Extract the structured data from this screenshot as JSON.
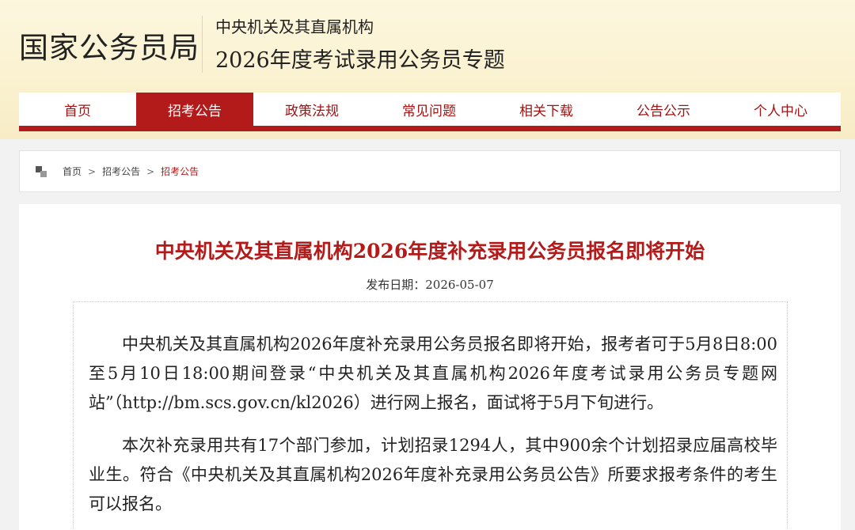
{
  "header": {
    "logo_text": "国家公务员局",
    "subtitle_small": "中央机关及其直属机构",
    "subtitle_large": "2026年度考试录用公务员专题"
  },
  "nav": {
    "items": [
      {
        "label": "首页"
      },
      {
        "label": "招考公告"
      },
      {
        "label": "政策法规"
      },
      {
        "label": "常见问题"
      },
      {
        "label": "相关下载"
      },
      {
        "label": "公告公示"
      },
      {
        "label": "个人中心"
      }
    ],
    "active_index": 1
  },
  "breadcrumb": {
    "icon": "home-icon",
    "items": [
      "首页",
      "招考公告",
      "招考公告"
    ],
    "separator": ">"
  },
  "article": {
    "title": "中央机关及其直属机构2026年度补充录用公务员报名即将开始",
    "date": "发布日期：2026-05-07",
    "paragraphs": [
      "中央机关及其直属机构2026年度补充录用公务员报名即将开始，报考者可于5月8日8:00至5月10日18:00期间登录“中央机关及其直属机构2026年度考试录用公务员专题网站”（http://bm.scs.gov.cn/kl2026）进行网上报名，面试将于5月下旬进行。",
      "本次补充录用共有17个部门参加，计划招录1294人，其中900余个计划招录应届高校毕业生。符合《中央机关及其直属机构2026年度补充录用公务员公告》所要求报考条件的考生可以报名。"
    ]
  },
  "colors": {
    "brand_red": "#b31b1b",
    "header_bg": "#fdf7df"
  }
}
